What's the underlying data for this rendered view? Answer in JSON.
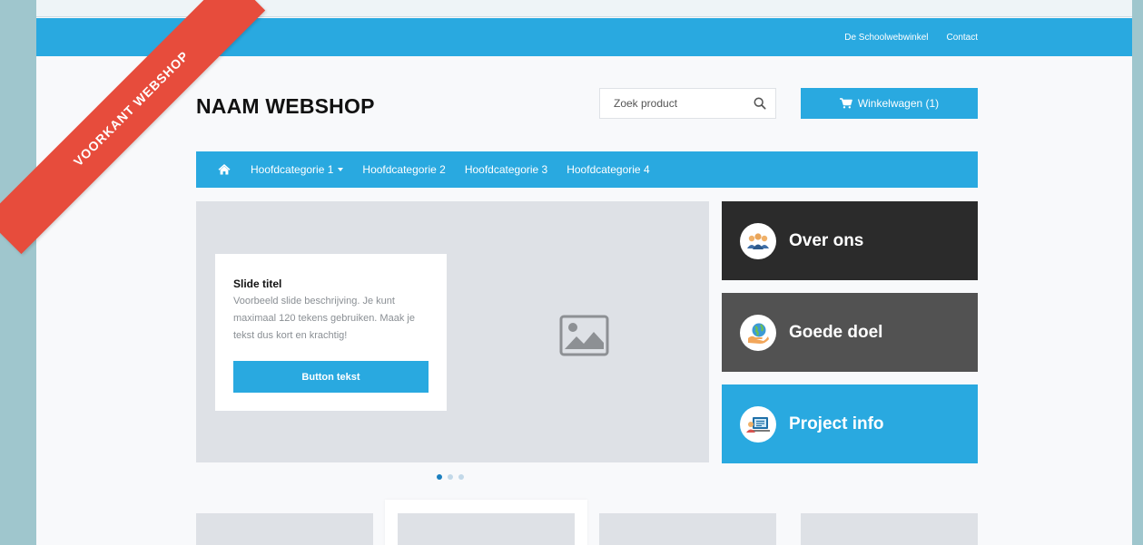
{
  "ribbon": {
    "text": "VOORKANT WEBSHOP"
  },
  "top_bar": {
    "links": [
      "De Schoolwebwinkel",
      "Contact"
    ]
  },
  "header": {
    "logo": "NAAM WEBSHOP",
    "search": {
      "placeholder": "Zoek product",
      "value": ""
    },
    "cart_label": "Winkelwagen (1)"
  },
  "nav": {
    "items": [
      {
        "label": "Hoofdcategorie 1",
        "has_dropdown": true
      },
      {
        "label": "Hoofdcategorie 2",
        "has_dropdown": false
      },
      {
        "label": "Hoofdcategorie 3",
        "has_dropdown": false
      },
      {
        "label": "Hoofdcategorie 4",
        "has_dropdown": false
      }
    ]
  },
  "slider": {
    "title": "Slide titel",
    "description": "Voorbeeld slide beschrijving. Je kunt maximaal 120 tekens gebruiken. Maak je tekst dus kort en krachtig!",
    "button_label": "Button tekst",
    "dots": 3,
    "active_dot": 0
  },
  "tiles": [
    {
      "label": "Over ons",
      "icon": "team-icon",
      "color": "#2b2b2b"
    },
    {
      "label": "Goede doel",
      "icon": "globe-hand-icon",
      "color": "#525252"
    },
    {
      "label": "Project info",
      "icon": "presentation-icon",
      "color": "#29a9e0"
    }
  ],
  "colors": {
    "accent": "#29a9e0",
    "ribbon": "#e74c3c",
    "frame": "#9fc6cd"
  }
}
